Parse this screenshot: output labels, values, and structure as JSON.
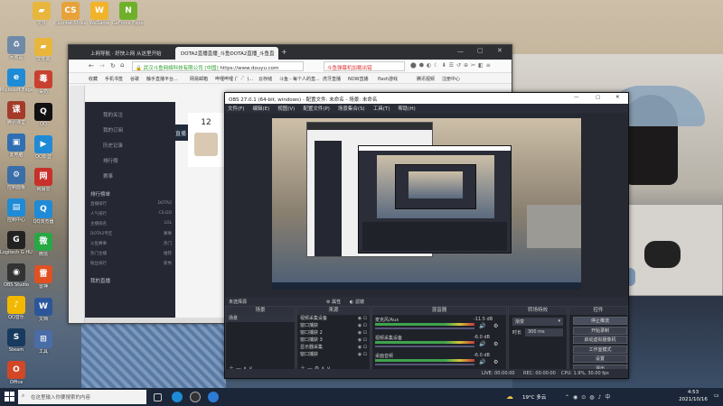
{
  "desktop": {
    "icons": [
      {
        "label": "回收站",
        "color": "#6e8aa8",
        "glyph": "♻"
      },
      {
        "label": "Microsoft Edge",
        "color": "#1f8bd6",
        "glyph": "e"
      },
      {
        "label": "腾讯课堂",
        "color": "#a43b2a",
        "glyph": "课"
      },
      {
        "label": "此电脑",
        "color": "#2f6fb2",
        "glyph": "▣"
      },
      {
        "label": "控制面板",
        "color": "#3a6ea8",
        "glyph": "⚙"
      },
      {
        "label": "控制中心",
        "color": "#1f8bd6",
        "glyph": "▤"
      },
      {
        "label": "Logitech G HUB",
        "color": "#222",
        "glyph": "G"
      },
      {
        "label": "OBS Studio",
        "color": "#333",
        "glyph": "◉"
      },
      {
        "label": "QQ音乐",
        "color": "#f2b800",
        "glyph": "♪"
      },
      {
        "label": "Steam",
        "color": "#173a5e",
        "glyph": "S"
      },
      {
        "label": "Office",
        "color": "#d24726",
        "glyph": "O"
      }
    ],
    "icons_col2": [
      {
        "label": "文件夹",
        "color": "#e8b63c",
        "glyph": "▰"
      },
      {
        "label": "毒奶",
        "color": "#c8412f",
        "glyph": "毒"
      },
      {
        "label": "QQ",
        "color": "#111",
        "glyph": "Q"
      },
      {
        "label": "QQ影音",
        "color": "#1f8bd6",
        "glyph": "▶"
      },
      {
        "label": "网易云",
        "color": "#c8302a",
        "glyph": "网"
      },
      {
        "label": "QQ浏览器",
        "color": "#1f8bd6",
        "glyph": "Q"
      },
      {
        "label": "微信",
        "color": "#27a844",
        "glyph": "微"
      },
      {
        "label": "雷神",
        "color": "#e05022",
        "glyph": "雷"
      },
      {
        "label": "文档",
        "color": "#2b579a",
        "glyph": "W"
      },
      {
        "label": "工具",
        "color": "#4a6da8",
        "glyph": "⊞"
      }
    ],
    "icons_top": [
      {
        "label": "文件",
        "color": "#e8b63c",
        "glyph": "▰"
      },
      {
        "label": "Counter-Strike Global Off.",
        "color": "#e8a23a",
        "glyph": "CS"
      },
      {
        "label": "WeGame",
        "color": "#f0b32a",
        "glyph": "W"
      },
      {
        "label": "GeForce Experience",
        "color": "#6fb02a",
        "glyph": "N"
      }
    ]
  },
  "browser": {
    "tabs": [
      {
        "label": "上网导航 · 好快上网 从这里开始"
      },
      {
        "label": "DOTA2直播直播_斗鱼DOTA2直播_斗鱼直"
      }
    ],
    "url_site": "武汉斗鱼网络科技有限公司",
    "url_cert": "[中国]",
    "url": "https://www.douyu.com",
    "search_placeholder": "斗鱼弹幕机加载出错",
    "bookmarks": [
      "收藏",
      "手机书签",
      "谷歌",
      "触手直播平台...",
      "网易邮箱",
      "哔哩哔哩 (゜-゜)...",
      "云存储",
      "斗鱼 - 每个人的直...",
      "虎牙直播",
      "NOW直播",
      "flash游戏",
      "腾讯视频",
      "注册中心"
    ],
    "dy_nav": [
      "首页",
      "直播",
      "分类",
      "游戏"
    ],
    "side_items": [
      "我的关注",
      "我的订阅",
      "历史记录",
      "排行榜",
      "赛事"
    ],
    "rank_title": "排行榜单",
    "rank_rows": [
      [
        "直播排行",
        "DOTA2"
      ],
      [
        "人气排行",
        "CS:GO"
      ],
      [
        "主播排名",
        "LOL"
      ],
      [
        "DOTA2专区",
        "赛事"
      ],
      [
        "斗鱼赛事",
        "热门"
      ],
      [
        "热门主播",
        "推荐"
      ],
      [
        "粉丝排行",
        "新秀"
      ]
    ],
    "my_title": "我的直播",
    "follow_count": "12"
  },
  "obs": {
    "title": "OBS 27.0.1 (64-bit, windows) - 配置文件: 未命名 - 场景: 未命名",
    "menu": [
      "文件(F)",
      "编辑(E)",
      "视图(V)",
      "配置文件(P)",
      "场景集合(S)",
      "工具(T)",
      "帮助(H)"
    ],
    "toolbar_label": "未选择源",
    "toolbar_props": "属性",
    "toolbar_filters": "滤镜",
    "scenes_header": "场景",
    "scenes": [
      "场景"
    ],
    "sources_header": "来源",
    "sources": [
      "视频采集设备",
      "窗口捕获",
      "窗口捕获 2",
      "窗口捕获 3",
      "显示器采集",
      "窗口捕获"
    ],
    "mixer_header": "混音器",
    "mixer": [
      {
        "name": "麦克风/Aux",
        "db": "-11.5 dB"
      },
      {
        "name": "视频采集设备",
        "db": "-6.0 dB"
      },
      {
        "name": "桌面音频",
        "db": "-6.0 dB"
      }
    ],
    "transitions_header": "转场特效",
    "transition_type": "渐变",
    "duration_label": "时长",
    "duration_value": "300 ms",
    "controls_header": "控件",
    "controls": [
      "停止推流",
      "开始录制",
      "启动虚拟摄像机",
      "工作室模式",
      "设置",
      "退出"
    ],
    "status": [
      "LIVE: 00:00:00",
      "REC: 00:00:00",
      "CPU: 1.9%, 30.00 fps"
    ]
  },
  "taskbar": {
    "search_placeholder": "在这里输入你要搜索的内容",
    "weather": "19°C 多云",
    "time": "4:53",
    "date": "2021/10/16"
  }
}
